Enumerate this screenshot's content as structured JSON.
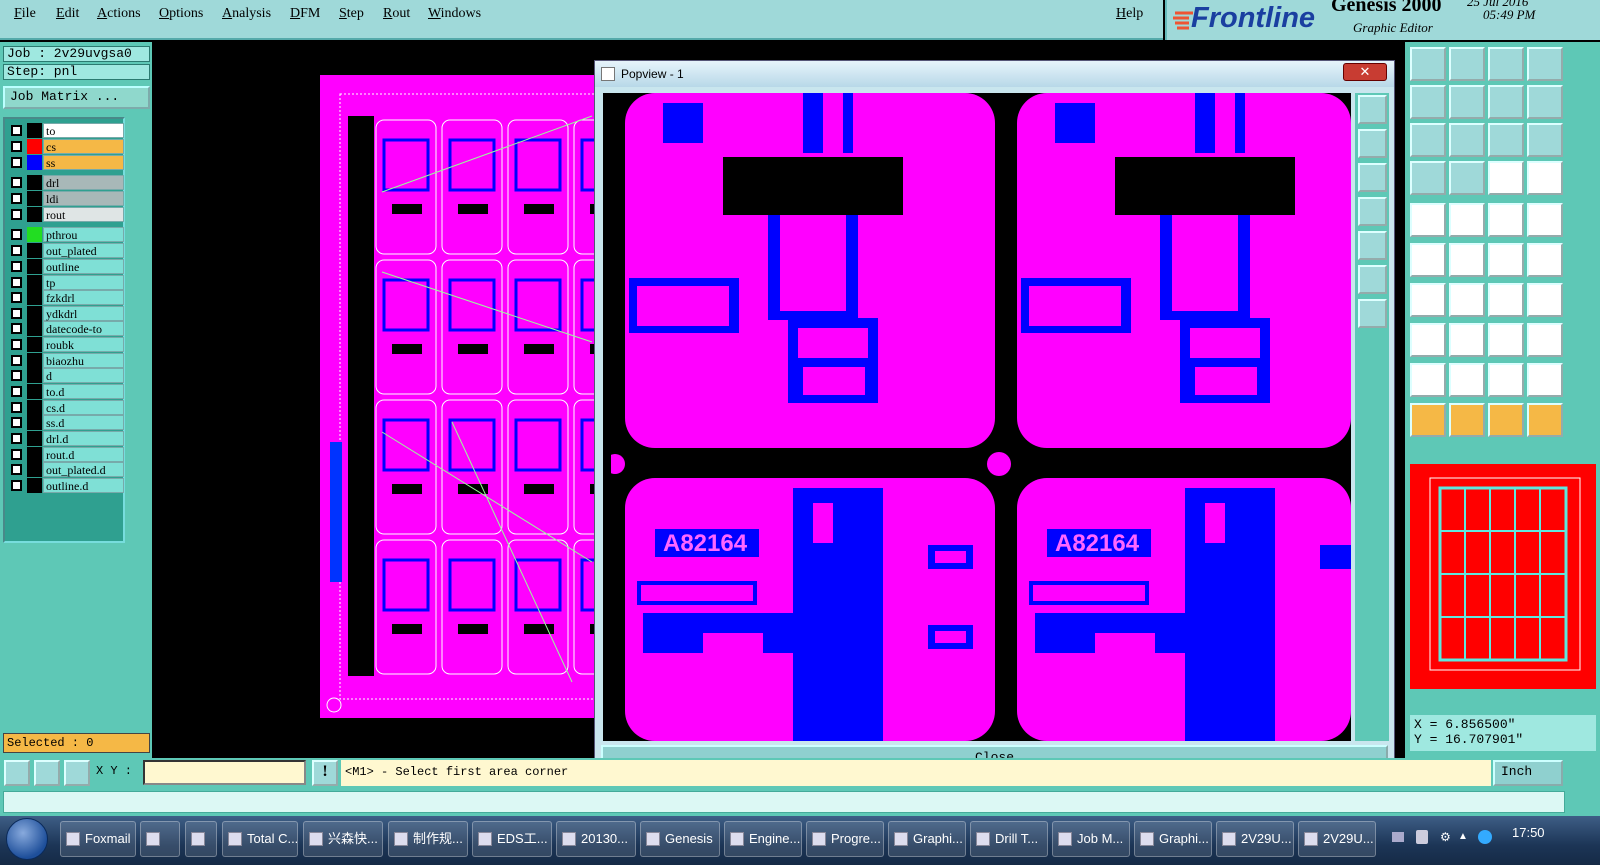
{
  "menu": [
    "File",
    "Edit",
    "Actions",
    "Options",
    "Analysis",
    "DFM",
    "Step",
    "Rout",
    "Windows"
  ],
  "help": "Help",
  "brand": {
    "logo": "Frontline",
    "product": "Genesis 2000",
    "subtitle": "Graphic Editor",
    "date": "25 Jul 2016",
    "time": "05:49 PM"
  },
  "job": "Job : 2v29uvgsa0",
  "step": "Step: pnl",
  "job_matrix": "Job Matrix ...",
  "layers": [
    {
      "name": "to",
      "color": "#000000",
      "bg": "#ffffff"
    },
    {
      "name": "cs",
      "color": "#ff0000",
      "bg": "#f5b846"
    },
    {
      "name": "ss",
      "color": "#0000ff",
      "bg": "#f5b846"
    },
    {
      "name": "drl",
      "color": "#000000",
      "bg": "#a8b8b8"
    },
    {
      "name": "ldi",
      "color": "#000000",
      "bg": "#a8b8b8"
    },
    {
      "name": "rout",
      "color": "#000000",
      "bg": "#dfe5e5"
    },
    {
      "name": "pthrou",
      "color": "#22dd22",
      "bg": "#7fe0d6"
    },
    {
      "name": "out_plated",
      "color": "#000000",
      "bg": "#7fe0d6"
    },
    {
      "name": "outline",
      "color": "#000000",
      "bg": "#7fe0d6"
    },
    {
      "name": "tp",
      "color": "#000000",
      "bg": "#7fe0d6"
    },
    {
      "name": "fzkdrl",
      "color": "#000000",
      "bg": "#7fe0d6"
    },
    {
      "name": "ydkdrl",
      "color": "#000000",
      "bg": "#7fe0d6"
    },
    {
      "name": "datecode-to",
      "color": "#000000",
      "bg": "#7fe0d6"
    },
    {
      "name": "roubk",
      "color": "#000000",
      "bg": "#7fe0d6"
    },
    {
      "name": "biaozhu",
      "color": "#000000",
      "bg": "#7fe0d6"
    },
    {
      "name": "d",
      "color": "#000000",
      "bg": "#7fe0d6"
    },
    {
      "name": "to.d",
      "color": "#000000",
      "bg": "#7fe0d6"
    },
    {
      "name": "cs.d",
      "color": "#000000",
      "bg": "#7fe0d6"
    },
    {
      "name": "ss.d",
      "color": "#000000",
      "bg": "#7fe0d6"
    },
    {
      "name": "drl.d",
      "color": "#000000",
      "bg": "#7fe0d6"
    },
    {
      "name": "rout.d",
      "color": "#000000",
      "bg": "#7fe0d6"
    },
    {
      "name": "out_plated.d",
      "color": "#000000",
      "bg": "#7fe0d6"
    },
    {
      "name": "outline.d",
      "color": "#000000",
      "bg": "#7fe0d6"
    }
  ],
  "selected": "Selected : 0",
  "popview": {
    "title": "Popview - 1",
    "close_x": "✕",
    "close_button": "Close",
    "label": "A82164"
  },
  "xy_label": "X Y :",
  "xy_value": "",
  "prompt": "<M1> - Select first area corner",
  "units": "Inch",
  "coords": {
    "x": "X = 6.856500\"",
    "y": "Y = 16.707901\""
  },
  "taskbar": [
    "Foxmail",
    "",
    "",
    "Total C...",
    "兴森快...",
    "制作规...",
    "EDS工...",
    "20130...",
    "Genesis",
    "Engine...",
    "Progre...",
    "Graphi...",
    "Drill T...",
    "Job M...",
    "Graphi...",
    "2V29U...",
    "2V29U..."
  ],
  "clock": "17:50",
  "colors": {
    "panel": "#5ec8b6",
    "menubar": "#9fd9d9",
    "copper": "#ff00ff",
    "mask": "#0000ff",
    "board_red": "#ff0000",
    "accent_orange": "#f5b846"
  }
}
